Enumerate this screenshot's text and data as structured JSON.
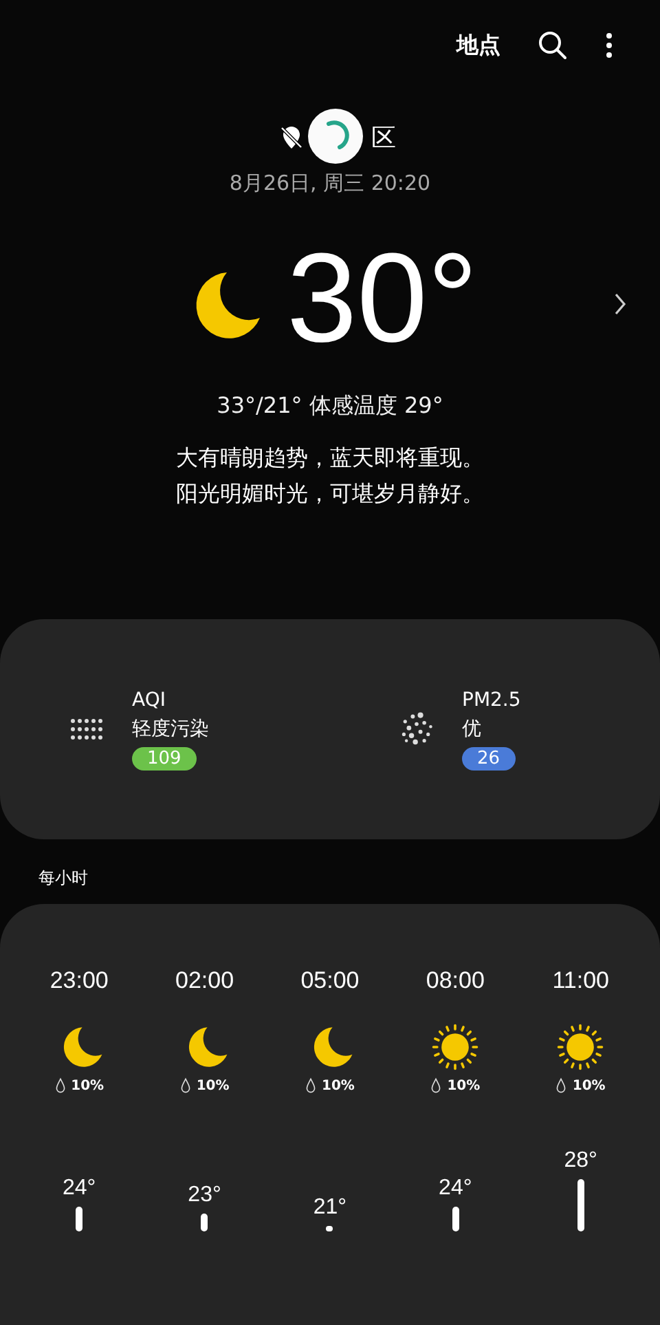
{
  "header": {
    "title": "地点"
  },
  "location": {
    "name": "区",
    "date": "8月26日, 周三 20:20",
    "loading": true
  },
  "current": {
    "kind": "moon",
    "temp": "30°",
    "range": "33°/21° 体感温度 29°"
  },
  "description": [
    "大有晴朗趋势，蓝天即将重现。",
    "阳光明媚时光，可堪岁月静好。"
  ],
  "air": [
    {
      "kind": "dots",
      "label": "AQI",
      "status": "轻度污染",
      "value": "109",
      "color": "#6cc24a"
    },
    {
      "kind": "particles",
      "label": "PM2.5",
      "status": "优",
      "value": "26",
      "color": "#4a7bd8"
    }
  ],
  "hourly": {
    "title": "每小时",
    "items": [
      {
        "time": "23:00",
        "kind": "moon",
        "rain": "10%",
        "temp": "24°"
      },
      {
        "time": "02:00",
        "kind": "moon",
        "rain": "10%",
        "temp": "23°"
      },
      {
        "time": "05:00",
        "kind": "moon",
        "rain": "10%",
        "temp": "21°"
      },
      {
        "time": "08:00",
        "kind": "sun",
        "rain": "10%",
        "temp": "24°"
      },
      {
        "time": "11:00",
        "kind": "sun",
        "rain": "10%",
        "temp": "28°"
      }
    ]
  }
}
